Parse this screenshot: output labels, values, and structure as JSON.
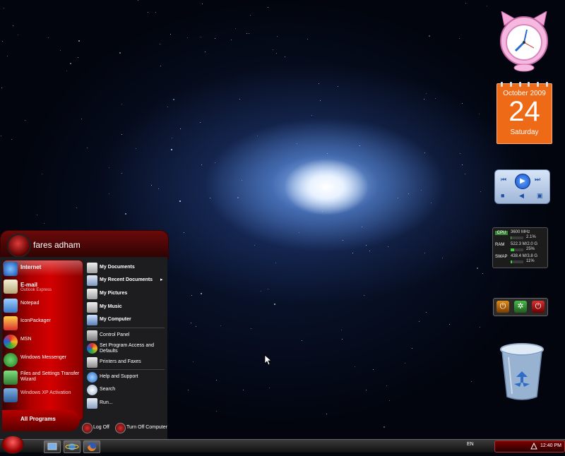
{
  "calendar": {
    "month": "October 2009",
    "day": "24",
    "weekday": "Saturday"
  },
  "meter": {
    "rows": [
      {
        "label": "CPU",
        "value": "3600 MHz",
        "detail": "2.1%",
        "level": 0.021
      },
      {
        "label": "RAM",
        "value": "522.3 M/2.0 G",
        "detail": "25%",
        "level": 0.25
      },
      {
        "label": "SWAP",
        "value": "438.4 M/3.8 G",
        "detail": "11%",
        "level": 0.11
      }
    ]
  },
  "start_menu": {
    "user": "fares adham",
    "pinned": [
      {
        "label": "Internet",
        "sub": "",
        "bold": true
      },
      {
        "label": "E-mail",
        "sub": "Outlook Express",
        "bold": true
      },
      {
        "label": "Notepad",
        "sub": "",
        "bold": false
      },
      {
        "label": "IconPackager",
        "sub": "",
        "bold": false
      },
      {
        "label": "MSN",
        "sub": "",
        "bold": false
      },
      {
        "label": "Windows Messenger",
        "sub": "",
        "bold": false
      },
      {
        "label": "Files and Settings Transfer Wizard",
        "sub": "",
        "bold": false
      },
      {
        "label": "Windows XP Activation",
        "sub": "",
        "bold": false
      }
    ],
    "all_programs": "All Programs",
    "places": [
      {
        "label": "My Documents",
        "bold": true
      },
      {
        "label": "My Recent Documents",
        "bold": true
      },
      {
        "label": "My Pictures",
        "bold": true
      },
      {
        "label": "My Music",
        "bold": true
      },
      {
        "label": "My Computer",
        "bold": true
      }
    ],
    "system": [
      {
        "label": "Control Panel"
      },
      {
        "label": "Set Program Access and Defaults"
      },
      {
        "label": "Printers and Faxes"
      }
    ],
    "help": [
      {
        "label": "Help and Support"
      },
      {
        "label": "Search"
      },
      {
        "label": "Run..."
      }
    ],
    "log_off": "Log Off",
    "turn_off": "Turn Off Computer"
  },
  "taskbar": {
    "language": "EN",
    "time": "12:40 PM"
  }
}
